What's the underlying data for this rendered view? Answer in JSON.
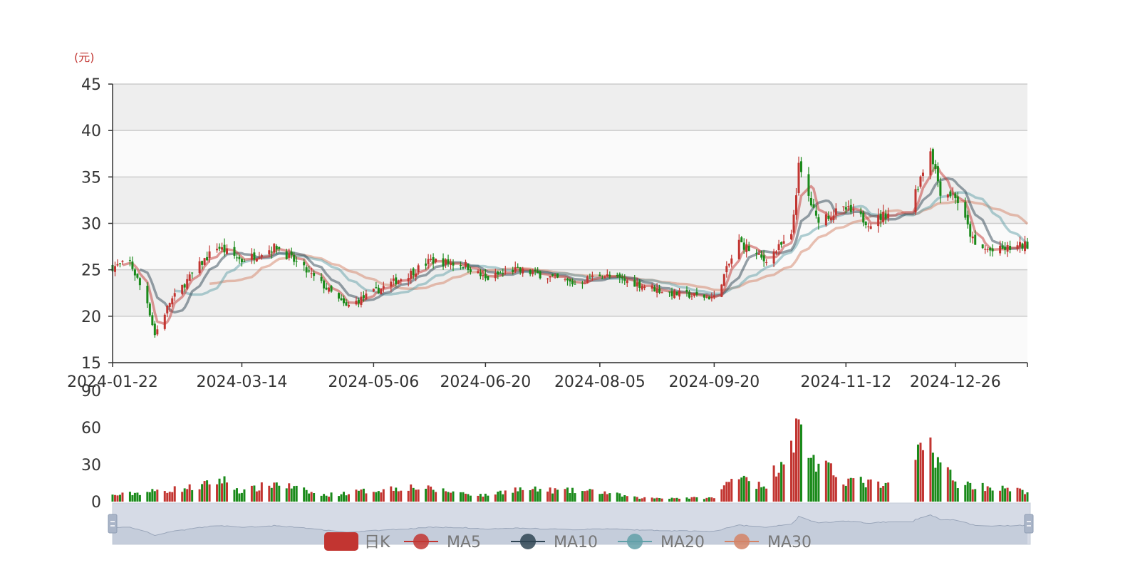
{
  "chart_data": {
    "type": "candlestick",
    "unit_label": "(元)",
    "price_axis": {
      "min": 15,
      "max": 45,
      "ticks": [
        15,
        20,
        25,
        30,
        35,
        40,
        45
      ],
      "grid": true,
      "banded": true
    },
    "x_axis": {
      "first_date": "2024-01-22",
      "last_date": "2025-01-24",
      "tick_labels": [
        "2024-01-22",
        "2024-03-14",
        "2024-05-06",
        "2024-06-20",
        "2024-08-05",
        "2024-09-20",
        "2024-11-12",
        "2024-12-26"
      ]
    },
    "volume_axis": {
      "min": 0,
      "max": 90,
      "ticks": [
        0,
        30,
        60,
        90
      ]
    },
    "legend": [
      {
        "name": "日K",
        "color": "#c23531"
      },
      {
        "name": "MA5",
        "color": "#c23531"
      },
      {
        "name": "MA10",
        "color": "#2f4554"
      },
      {
        "name": "MA20",
        "color": "#61a0a8"
      },
      {
        "name": "MA30",
        "color": "#d48265"
      }
    ],
    "colors": {
      "up": "#c23531",
      "down": "#1a8a1a",
      "ma5": "#c23531",
      "ma10": "#2f4554",
      "ma20": "#61a0a8",
      "ma30": "#d48265"
    },
    "close_keypoints": [
      {
        "date": "2024-01-22",
        "close": 25.3
      },
      {
        "date": "2024-01-29",
        "close": 25.8
      },
      {
        "date": "2024-02-05",
        "close": 21.5
      },
      {
        "date": "2024-02-08",
        "close": 18.0
      },
      {
        "date": "2024-02-14",
        "close": 21.5
      },
      {
        "date": "2024-02-26",
        "close": 25.5
      },
      {
        "date": "2024-03-04",
        "close": 27.5
      },
      {
        "date": "2024-03-14",
        "close": 26.0
      },
      {
        "date": "2024-03-28",
        "close": 27.5
      },
      {
        "date": "2024-04-15",
        "close": 23.5
      },
      {
        "date": "2024-04-25",
        "close": 21.0
      },
      {
        "date": "2024-05-06",
        "close": 22.6
      },
      {
        "date": "2024-05-20",
        "close": 24.5
      },
      {
        "date": "2024-05-29",
        "close": 26.0
      },
      {
        "date": "2024-06-12",
        "close": 25.5
      },
      {
        "date": "2024-06-20",
        "close": 24.0
      },
      {
        "date": "2024-07-01",
        "close": 25.0
      },
      {
        "date": "2024-07-12",
        "close": 24.5
      },
      {
        "date": "2024-07-26",
        "close": 23.5
      },
      {
        "date": "2024-08-05",
        "close": 24.5
      },
      {
        "date": "2024-08-20",
        "close": 23.5
      },
      {
        "date": "2024-09-02",
        "close": 22.5
      },
      {
        "date": "2024-09-20",
        "close": 22.0
      },
      {
        "date": "2024-09-30",
        "close": 28.0
      },
      {
        "date": "2024-10-10",
        "close": 26.0
      },
      {
        "date": "2024-10-21",
        "close": 28.5
      },
      {
        "date": "2024-10-24",
        "close": 36.0
      },
      {
        "date": "2024-10-31",
        "close": 30.5
      },
      {
        "date": "2024-11-12",
        "close": 31.5
      },
      {
        "date": "2024-11-22",
        "close": 30.0
      },
      {
        "date": "2024-11-29",
        "close": 31.2
      },
      {
        "date": "2024-12-09",
        "close": 31.2
      },
      {
        "date": "2024-12-10",
        "close": 33.5
      },
      {
        "date": "2024-12-16",
        "close": 38.0
      },
      {
        "date": "2024-12-20",
        "close": 33.5
      },
      {
        "date": "2024-12-26",
        "close": 33.0
      },
      {
        "date": "2025-01-03",
        "close": 27.5
      },
      {
        "date": "2025-01-10",
        "close": 27.0
      },
      {
        "date": "2025-01-24",
        "close": 27.7
      }
    ],
    "volume_keypoints": [
      {
        "date": "2024-01-22",
        "volume": 5
      },
      {
        "date": "2024-02-26",
        "volume": 12
      },
      {
        "date": "2024-03-06",
        "volume": 18
      },
      {
        "date": "2024-03-14",
        "volume": 8
      },
      {
        "date": "2024-03-28",
        "volume": 15
      },
      {
        "date": "2024-04-15",
        "volume": 5
      },
      {
        "date": "2024-05-20",
        "volume": 12
      },
      {
        "date": "2024-06-20",
        "volume": 5
      },
      {
        "date": "2024-07-01",
        "volume": 10
      },
      {
        "date": "2024-08-05",
        "volume": 8
      },
      {
        "date": "2024-08-20",
        "volume": 3
      },
      {
        "date": "2024-09-20",
        "volume": 3
      },
      {
        "date": "2024-09-30",
        "volume": 25
      },
      {
        "date": "2024-10-10",
        "volume": 10
      },
      {
        "date": "2024-10-24",
        "volume": 60
      },
      {
        "date": "2024-10-31",
        "volume": 30
      },
      {
        "date": "2024-11-12",
        "volume": 18
      },
      {
        "date": "2024-11-29",
        "volume": 12
      },
      {
        "date": "2024-12-09",
        "volume": 0
      },
      {
        "date": "2024-12-10",
        "volume": 38
      },
      {
        "date": "2024-12-16",
        "volume": 45
      },
      {
        "date": "2024-12-26",
        "volume": 15
      },
      {
        "date": "2025-01-24",
        "volume": 8
      }
    ],
    "no_trade_ranges": [
      [
        "2024-12-02",
        "2024-12-09"
      ]
    ]
  }
}
